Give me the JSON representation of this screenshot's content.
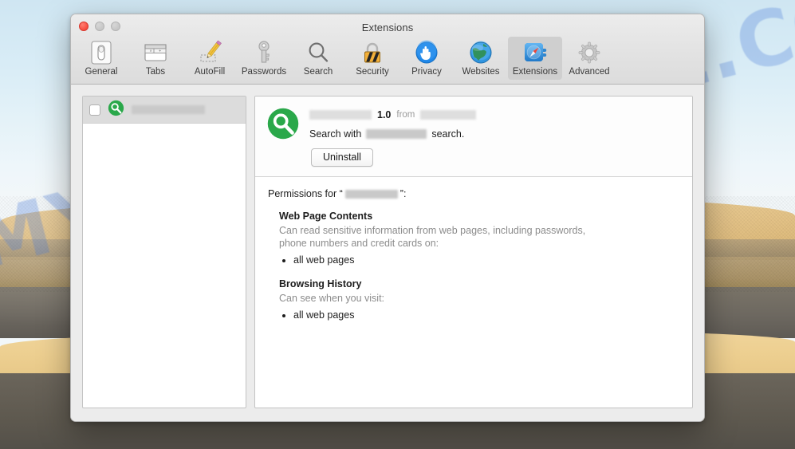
{
  "desktop": {
    "wallpaper_name": "mojave-desert-dunes",
    "sky_color": "#d8ecf6",
    "sand_color": "#e3c184",
    "shadow_color": "#6d6860"
  },
  "watermark": {
    "text": "MYANTISPYWARE.COM",
    "color": "#4a7cd6"
  },
  "window": {
    "title": "Extensions",
    "traffic_lights": [
      {
        "name": "close",
        "color": "#f6483b",
        "enabled": true
      },
      {
        "name": "minimize",
        "color": "#c4c4c4",
        "enabled": false
      },
      {
        "name": "zoom",
        "color": "#c4c4c4",
        "enabled": false
      }
    ]
  },
  "toolbar": {
    "items": [
      {
        "label": "General",
        "icon": "general-icon",
        "selected": false
      },
      {
        "label": "Tabs",
        "icon": "tabs-icon",
        "selected": false
      },
      {
        "label": "AutoFill",
        "icon": "autofill-icon",
        "selected": false
      },
      {
        "label": "Passwords",
        "icon": "passwords-icon",
        "selected": false
      },
      {
        "label": "Search",
        "icon": "search-icon",
        "selected": false
      },
      {
        "label": "Security",
        "icon": "security-icon",
        "selected": false
      },
      {
        "label": "Privacy",
        "icon": "privacy-icon",
        "selected": false
      },
      {
        "label": "Websites",
        "icon": "websites-icon",
        "selected": false
      },
      {
        "label": "Extensions",
        "icon": "extensions-icon",
        "selected": true
      },
      {
        "label": "Advanced",
        "icon": "advanced-icon",
        "selected": false
      }
    ]
  },
  "extension_list": {
    "rows": [
      {
        "checked": false,
        "icon": "green-magnifier-icon",
        "name_redacted": true,
        "name": ""
      }
    ]
  },
  "detail": {
    "icon": "green-magnifier-icon",
    "name": "",
    "name_redacted": true,
    "version": "1.0",
    "from_label": "from",
    "publisher": "",
    "publisher_redacted": true,
    "description_prefix": "Search with",
    "description_suffix": "search.",
    "description_redacted": true,
    "uninstall_label": "Uninstall"
  },
  "permissions": {
    "heading_prefix": "Permissions for “",
    "heading_suffix": "”:",
    "heading_name_redacted": true,
    "groups": [
      {
        "title": "Web Page Contents",
        "body": "Can read sensitive information from web pages, including passwords, phone numbers and credit cards on:",
        "items": [
          "all web pages"
        ]
      },
      {
        "title": "Browsing History",
        "body": "Can see when you visit:",
        "items": [
          "all web pages"
        ]
      }
    ]
  }
}
